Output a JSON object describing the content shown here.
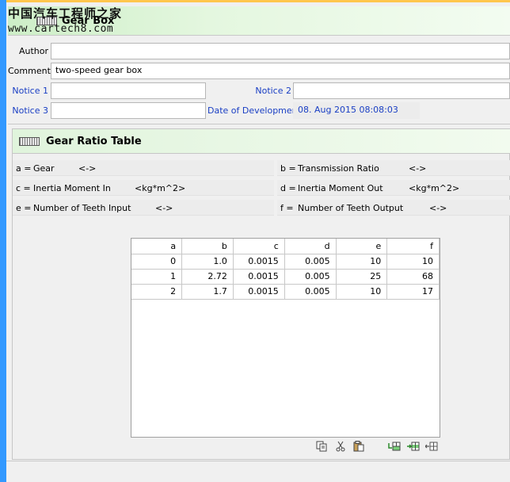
{
  "watermark": {
    "chinese": "中国汽车工程师之家",
    "url": "www.cartech8.com"
  },
  "header": {
    "title": "Gear Box"
  },
  "form": {
    "author_label": "Author",
    "author_value": "",
    "comment_label": "Comment",
    "comment_value": "two-speed gear box",
    "notice1_label": "Notice 1",
    "notice1_value": "",
    "notice2_label": "Notice 2",
    "notice2_value": "",
    "notice3_label": "Notice 3",
    "notice3_value": "",
    "date_label": "Date of Development",
    "date_value": "08. Aug 2015 08:08:03"
  },
  "section": {
    "title": "Gear Ratio Table",
    "columns_info": [
      {
        "key": "a =",
        "name": "Gear",
        "unit": "<->"
      },
      {
        "key": "b =",
        "name": "Transmission Ratio",
        "unit": "<->"
      },
      {
        "key": "c =",
        "name": "Inertia Moment In",
        "unit": "<kg*m^2>"
      },
      {
        "key": "d =",
        "name": "Inertia Moment Out",
        "unit": "<kg*m^2>"
      },
      {
        "key": "e =",
        "name": "Number of Teeth Input",
        "unit": "<->"
      },
      {
        "key": "f =",
        "name": "Number of Teeth Output",
        "unit": "<->"
      }
    ]
  },
  "table": {
    "headers": [
      "a",
      "b",
      "c",
      "d",
      "e",
      "f"
    ],
    "rows": [
      [
        "0",
        "1.0",
        "0.0015",
        "0.005",
        "10",
        "10"
      ],
      [
        "1",
        "2.72",
        "0.0015",
        "0.005",
        "25",
        "68"
      ],
      [
        "2",
        "1.7",
        "0.0015",
        "0.005",
        "10",
        "17"
      ]
    ]
  },
  "toolbar": {
    "icons": [
      "copy-icon",
      "cut-icon",
      "paste-icon",
      "insert-row-below-icon",
      "insert-row-icon",
      "delete-row-icon"
    ]
  },
  "colors": {
    "header_green": "#cdeec7",
    "label_blue": "#1a3fc4",
    "left_bar": "#3399ff"
  }
}
